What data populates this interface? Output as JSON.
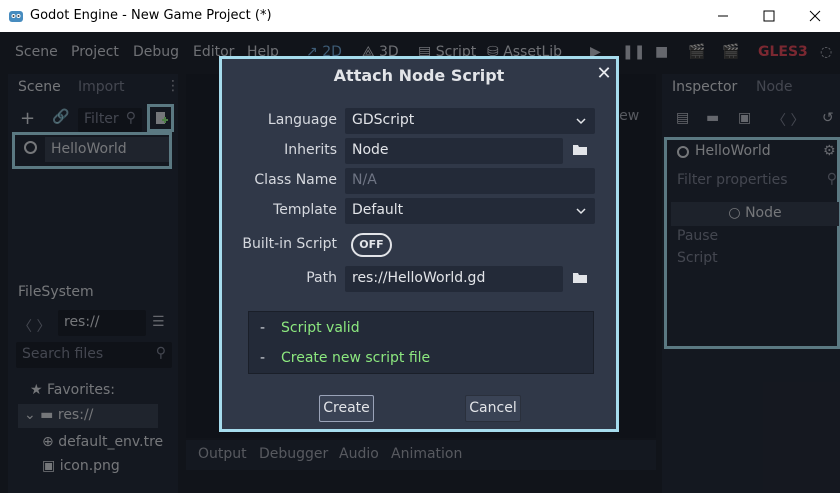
{
  "window": {
    "title": "Godot Engine - New Game Project (*)",
    "minimize_icon": "minimize-icon",
    "maximize_icon": "maximize-icon",
    "close_icon": "close-icon"
  },
  "menubar": {
    "items": [
      "Scene",
      "Project",
      "Debug",
      "Editor",
      "Help"
    ],
    "workspaces": [
      "2D",
      "3D",
      "Script",
      "AssetLib"
    ],
    "renderer": "GLES3"
  },
  "scene_dock": {
    "tabs": [
      "Scene",
      "Import"
    ],
    "filter_placeholder": "Filter",
    "root_node": "HelloWorld"
  },
  "filesystem_dock": {
    "tab": "FileSystem",
    "path": "res://",
    "search_placeholder": "Search files",
    "favorites_label": "Favorites:",
    "items": [
      "res://",
      "default_env.tre",
      "icon.png"
    ]
  },
  "viewport": {
    "view_label": "View"
  },
  "inspector": {
    "tabs": [
      "Inspector",
      "Node"
    ],
    "object_name": "HelloWorld",
    "filter_placeholder": "Filter properties",
    "section": "Node",
    "properties": [
      "Pause",
      "Script"
    ]
  },
  "bottom_panel": {
    "tabs": [
      "Output",
      "Debugger",
      "Audio",
      "Animation"
    ]
  },
  "dialog": {
    "title": "Attach Node Script",
    "language_label": "Language",
    "language_value": "GDScript",
    "inherits_label": "Inherits",
    "inherits_value": "Node",
    "class_name_label": "Class Name",
    "class_name_placeholder": "N/A",
    "template_label": "Template",
    "template_value": "Default",
    "builtin_label": "Built-in Script",
    "builtin_toggle": "OFF",
    "path_label": "Path",
    "path_value": "res://HelloWorld.gd",
    "status": [
      {
        "dash": "-",
        "text": "Script valid"
      },
      {
        "dash": "-",
        "text": "Create new script file"
      }
    ],
    "create_label": "Create",
    "cancel_label": "Cancel"
  },
  "colors": {
    "editor_bg": "#202531",
    "dialog_bg": "#303848",
    "highlight": "#a6dced",
    "status_ok": "#8ce87f"
  }
}
